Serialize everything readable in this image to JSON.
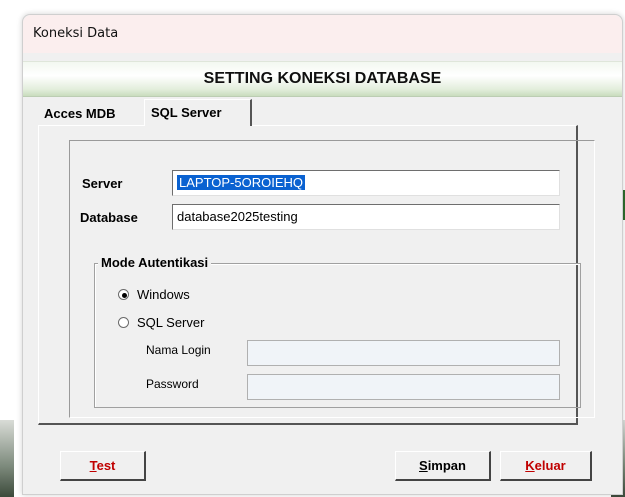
{
  "window": {
    "title": "Koneksi Data",
    "banner": "SETTING KONEKSI DATABASE"
  },
  "tabs": [
    {
      "label": "Acces MDB",
      "active": false
    },
    {
      "label": "SQL Server",
      "active": true
    }
  ],
  "form": {
    "server_label": "Server",
    "server_value": "LAPTOP-5OROIEHQ",
    "database_label": "Database",
    "database_value": "database2025testing"
  },
  "auth": {
    "legend": "Mode Autentikasi",
    "options": [
      {
        "label": "Windows",
        "selected": true
      },
      {
        "label": "SQL Server",
        "selected": false
      }
    ],
    "login_label": "Nama Login",
    "login_value": "",
    "password_label": "Password",
    "password_value": ""
  },
  "buttons": {
    "test_mnemonic": "T",
    "test_rest": "est",
    "save_mnemonic": "S",
    "save_rest": "impan",
    "exit_mnemonic": "K",
    "exit_rest": "eluar"
  },
  "colors": {
    "selection": "#0a62d1",
    "exit_text": "#c00000",
    "banner_green": "#c9dcbe",
    "titlebar": "#fbeeee"
  }
}
